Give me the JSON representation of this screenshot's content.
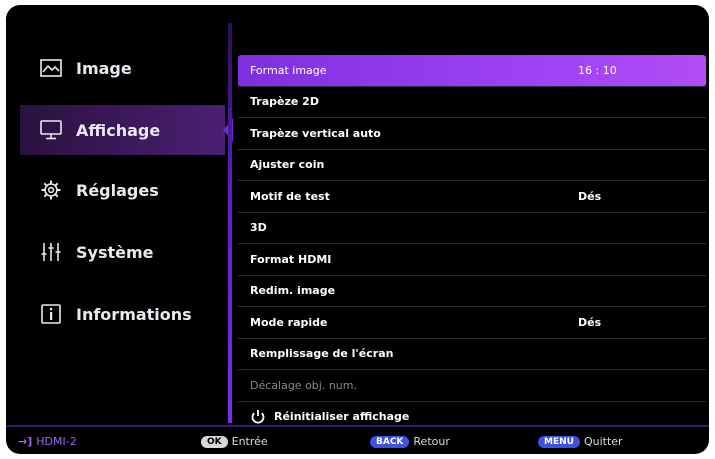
{
  "sidebar": {
    "items": [
      {
        "label": "Image",
        "icon": "picture-icon"
      },
      {
        "label": "Affichage",
        "icon": "monitor-icon",
        "active": true
      },
      {
        "label": "Réglages",
        "icon": "gear-icon"
      },
      {
        "label": "Système",
        "icon": "sliders-icon"
      },
      {
        "label": "Informations",
        "icon": "info-icon"
      }
    ]
  },
  "menu": {
    "items": [
      {
        "label": "Format image",
        "value": "16 : 10"
      },
      {
        "label": "Trapèze 2D",
        "value": ""
      },
      {
        "label": "Trapèze vertical auto",
        "value": ""
      },
      {
        "label": "Ajuster coin",
        "value": ""
      },
      {
        "label": "Motif de test",
        "value": "Dés"
      },
      {
        "label": "3D",
        "value": ""
      },
      {
        "label": "Format HDMI",
        "value": ""
      },
      {
        "label": "Redim. image",
        "value": ""
      },
      {
        "label": "Mode rapide",
        "value": "Dés"
      },
      {
        "label": "Remplissage de l'écran",
        "value": ""
      },
      {
        "label": "Décalage obj. num.",
        "value": ""
      },
      {
        "label": "Réinitialiser affichage",
        "value": ""
      }
    ]
  },
  "statusbar": {
    "source": "HDMI-2",
    "ok_key": "OK",
    "ok_label": "Entrée",
    "back_key": "BACK",
    "back_label": "Retour",
    "menu_key": "MENU",
    "menu_label": "Quitter"
  },
  "colors": {
    "accent": "#9c42f4",
    "divider": "#5b1fc0",
    "key_blue": "#3d52e0"
  }
}
